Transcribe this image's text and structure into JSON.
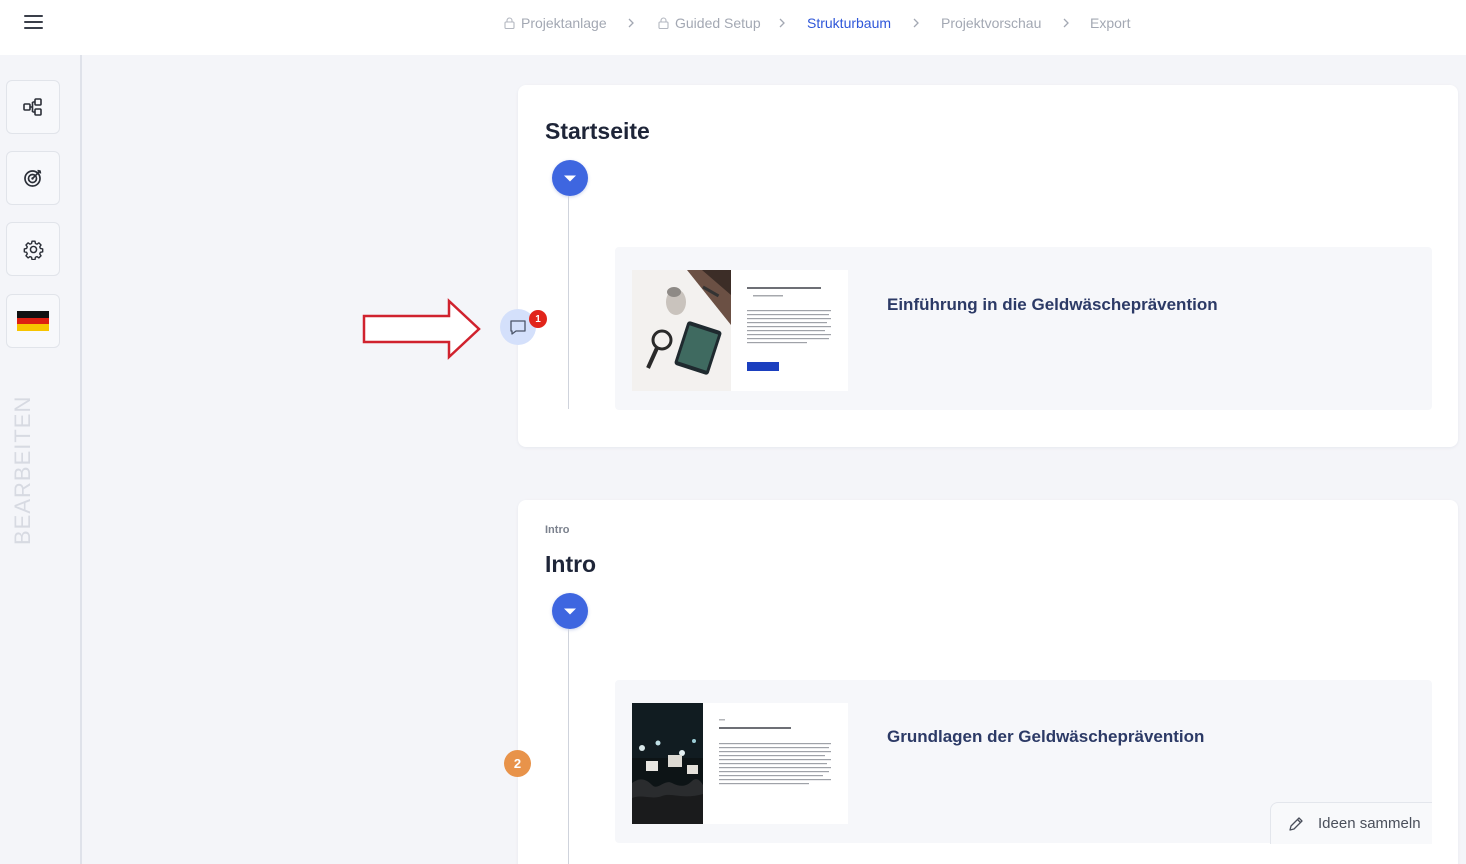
{
  "breadcrumb": {
    "steps": [
      {
        "label": "Projektanlage",
        "locked": true
      },
      {
        "label": "Guided Setup",
        "locked": true
      },
      {
        "label": "Strukturbaum",
        "active": true
      },
      {
        "label": "Projektvorschau"
      },
      {
        "label": "Export"
      }
    ]
  },
  "sidebar": {
    "vertical_label": "BEARBEITEN",
    "buttons": [
      {
        "icon": "sitemap-icon"
      },
      {
        "icon": "target-icon"
      },
      {
        "icon": "gear-icon"
      },
      {
        "icon": "german-flag-icon"
      }
    ]
  },
  "sections": [
    {
      "kicker": "",
      "title": "Startseite",
      "page": {
        "title": "Einführung in die Geldwäscheprävention"
      }
    },
    {
      "kicker": "Intro",
      "title": "Intro",
      "page": {
        "title": "Grundlagen der Geldwäscheprävention"
      }
    }
  ],
  "comment": {
    "count": "1"
  },
  "step_badge": {
    "number": "2"
  },
  "ideas_button": {
    "label": "Ideen sammeln"
  },
  "colors": {
    "accent": "#3e66e0",
    "active_breadcrumb": "#2f57d9",
    "badge_red": "#e1251b",
    "badge_orange": "#e8934a",
    "arrow_red": "#d0222e"
  }
}
